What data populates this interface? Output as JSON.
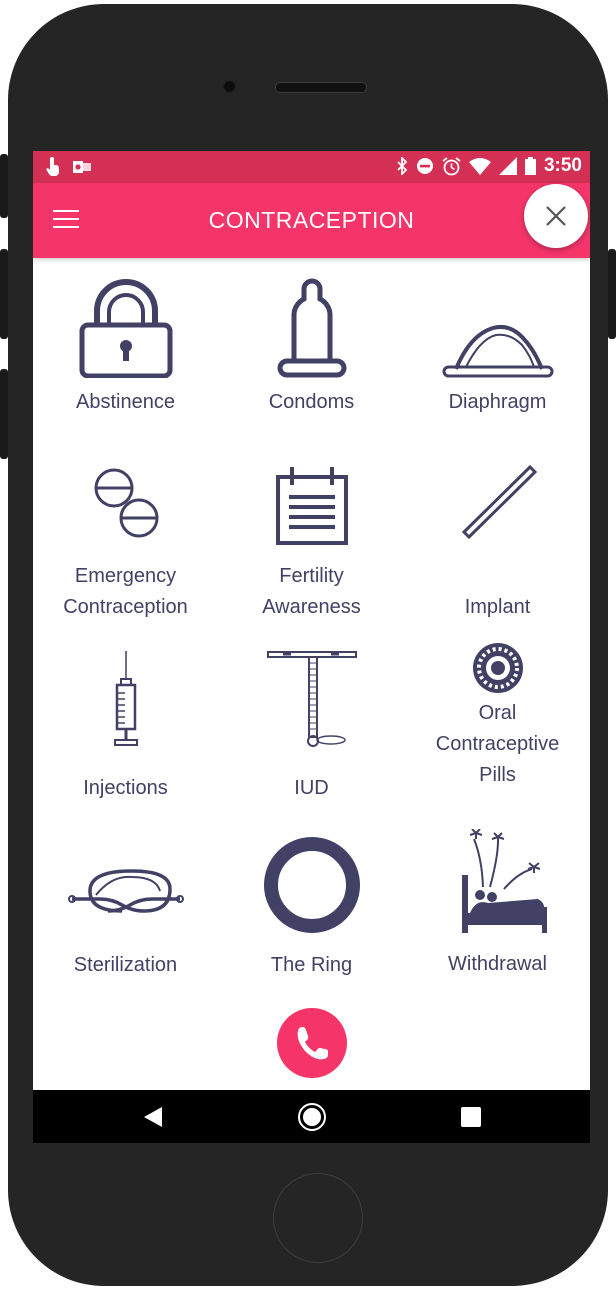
{
  "status_bar": {
    "time": "3:50"
  },
  "app_bar": {
    "title": "CONTRACEPTION"
  },
  "methods": [
    {
      "label_lines": [
        "Abstinence"
      ],
      "icon": "padlock-icon"
    },
    {
      "label_lines": [
        "Condoms"
      ],
      "icon": "condom-icon"
    },
    {
      "label_lines": [
        "Diaphragm"
      ],
      "icon": "diaphragm-icon"
    },
    {
      "label_lines": [
        "Emergency",
        "Contraception"
      ],
      "icon": "pills-icon"
    },
    {
      "label_lines": [
        "Fertility",
        "Awareness"
      ],
      "icon": "calendar-icon"
    },
    {
      "label_lines": [
        "Implant"
      ],
      "icon": "implant-rod-icon"
    },
    {
      "label_lines": [
        "Injections"
      ],
      "icon": "syringe-icon"
    },
    {
      "label_lines": [
        "IUD"
      ],
      "icon": "iud-icon"
    },
    {
      "label_lines": [
        "Oral",
        "Contraceptive",
        "Pills"
      ],
      "icon": "pill-pack-icon"
    },
    {
      "label_lines": [
        "Sterilization"
      ],
      "icon": "tied-tube-icon"
    },
    {
      "label_lines": [
        "The Ring"
      ],
      "icon": "ring-icon"
    },
    {
      "label_lines": [
        "Withdrawal"
      ],
      "icon": "bed-fireworks-icon"
    }
  ],
  "colors": {
    "status_bar": "#d42f54",
    "app_bar": "#f5356a",
    "icon": "#424165",
    "call_button": "#f5356a"
  }
}
